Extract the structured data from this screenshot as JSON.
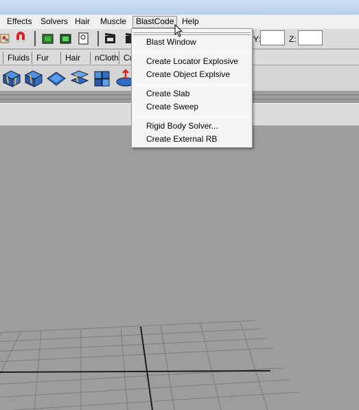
{
  "menubar": {
    "items": [
      "Effects",
      "Solvers",
      "Hair",
      "Muscle",
      "BlastCode",
      "Help"
    ],
    "active": "BlastCode"
  },
  "coords": {
    "y_label": "Y:",
    "z_label": "Z:"
  },
  "shelf_tabs": [
    "Fluids",
    "Fur",
    "Hair",
    "nCloth",
    "Cu"
  ],
  "dropdown": {
    "groups": [
      [
        "Blast Window"
      ],
      [
        "Create Locator Explosive",
        "Create Object Explsive"
      ],
      [
        "Create Slab",
        "Create Sweep"
      ],
      [
        "Rigid Body Solver...",
        "Create External RB"
      ]
    ]
  },
  "icons": {
    "toolbar": [
      "paint-icon",
      "magnet-snap-icon",
      "render-region-icon",
      "render-frame-icon",
      "render-settings-icon",
      "clapperboard-icon",
      "clapperboard-icon"
    ],
    "shelf": [
      "fluid-container-icon",
      "fluid-3d-icon",
      "fluid-2d-icon",
      "fluid-emitter-icon",
      "fluid-surface-icon",
      "fluid-ocean-icon",
      "fluid-pond-icon"
    ]
  }
}
